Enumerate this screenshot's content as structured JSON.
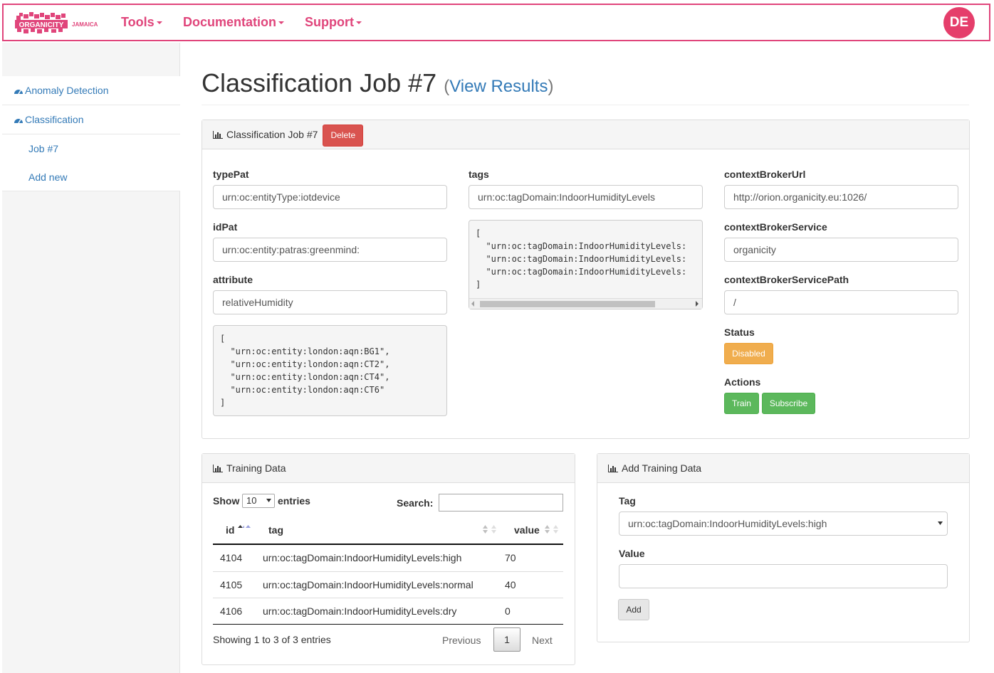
{
  "navbar": {
    "logo_text": "ORGANICITY",
    "logo_sub": "JAMAICA",
    "menu": [
      "Tools",
      "Documentation",
      "Support"
    ],
    "avatar": "DE"
  },
  "sidebar": {
    "items": [
      {
        "label": "Anomaly Detection",
        "icon": "dashboard-icon"
      },
      {
        "label": "Classification",
        "icon": "dashboard-icon"
      }
    ],
    "sub_items": [
      "Job #7",
      "Add new"
    ]
  },
  "page": {
    "title": "Classification Job #7",
    "view_results": "View Results"
  },
  "job_panel": {
    "heading": "Classification Job #7",
    "delete_label": "Delete",
    "typePat_label": "typePat",
    "typePat_value": "urn:oc:entityType:iotdevice",
    "idPat_label": "idPat",
    "idPat_value": "urn:oc:entity:patras:greenmind:",
    "attribute_label": "attribute",
    "attribute_value": "relativeHumidity",
    "entities_json": "[\n  \"urn:oc:entity:london:aqn:BG1\",\n  \"urn:oc:entity:london:aqn:CT2\",\n  \"urn:oc:entity:london:aqn:CT4\",\n  \"urn:oc:entity:london:aqn:CT6\"\n]",
    "tags_label": "tags",
    "tags_value": "urn:oc:tagDomain:IndoorHumidityLevels",
    "tags_json": "[\n  \"urn:oc:tagDomain:IndoorHumidityLevels:\n  \"urn:oc:tagDomain:IndoorHumidityLevels:\n  \"urn:oc:tagDomain:IndoorHumidityLevels:\n]",
    "cburl_label": "contextBrokerUrl",
    "cburl_value": "http://orion.organicity.eu:1026/",
    "cbservice_label": "contextBrokerService",
    "cbservice_value": "organicity",
    "cbpath_label": "contextBrokerServicePath",
    "cbpath_value": "/",
    "status_label": "Status",
    "status_value": "Disabled",
    "actions_label": "Actions",
    "train_label": "Train",
    "subscribe_label": "Subscribe"
  },
  "training": {
    "heading": "Training Data",
    "show_label": "Show",
    "show_value": "10",
    "entries_label": "entries",
    "search_label": "Search:",
    "columns": [
      "id",
      "tag",
      "value"
    ],
    "rows": [
      [
        "4104",
        "urn:oc:tagDomain:IndoorHumidityLevels:high",
        "70"
      ],
      [
        "4105",
        "urn:oc:tagDomain:IndoorHumidityLevels:normal",
        "40"
      ],
      [
        "4106",
        "urn:oc:tagDomain:IndoorHumidityLevels:dry",
        "0"
      ]
    ],
    "info": "Showing 1 to 3 of 3 entries",
    "previous": "Previous",
    "page": "1",
    "next": "Next"
  },
  "add_training": {
    "heading": "Add Training Data",
    "tag_label": "Tag",
    "tag_value": "urn:oc:tagDomain:IndoorHumidityLevels:high",
    "value_label": "Value",
    "value_value": "",
    "add_label": "Add"
  },
  "colors": {
    "brand": "#e0457b",
    "link": "#337ab7",
    "danger": "#d9534f",
    "warning": "#f0ad4e",
    "success": "#5cb85c"
  }
}
